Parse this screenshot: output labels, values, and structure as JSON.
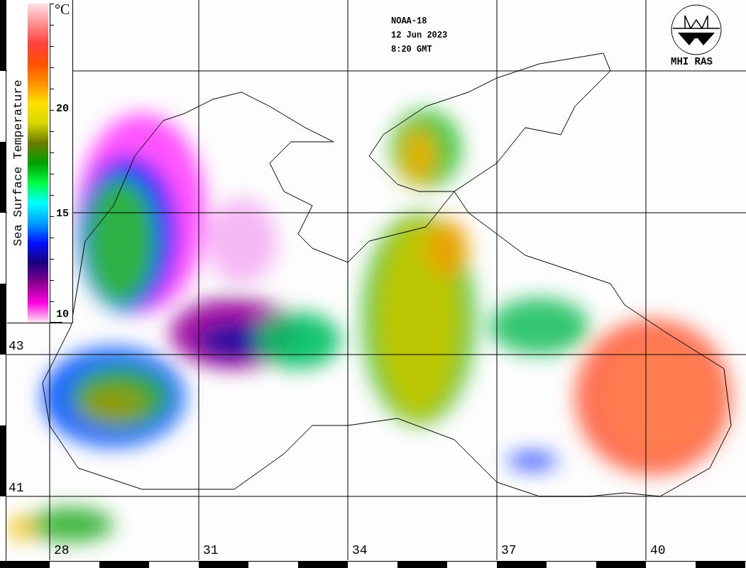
{
  "header": {
    "lines": [
      "NOAA-18",
      "12 Jun 2023",
      "8:20 GMT"
    ]
  },
  "logo": {
    "label": "MHI RAS"
  },
  "colorbar": {
    "title": "Sea Surface Temperature",
    "unit": "°C",
    "ticks": [
      "20",
      "15",
      "10"
    ]
  },
  "latitude_labels": [
    "43",
    "41"
  ],
  "longitude_labels": [
    "28",
    "31",
    "34",
    "37",
    "40"
  ]
}
